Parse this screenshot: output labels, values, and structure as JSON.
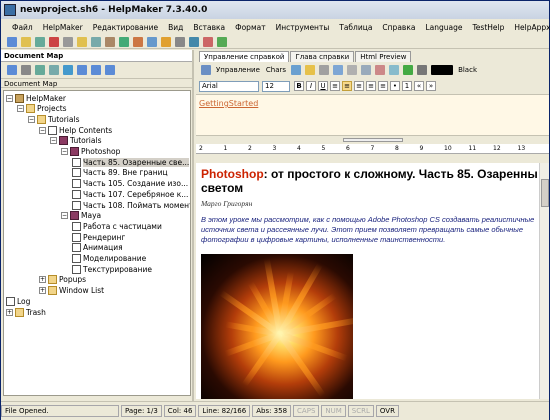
{
  "window": {
    "title": "newproject.sh6 - HelpMaker 7.3.40.0"
  },
  "menu": [
    "Файл",
    "HelpMaker",
    "Редактирование",
    "Вид",
    "Вставка",
    "Формат",
    "Инструменты",
    "Таблица",
    "Справка",
    "Language",
    "TestHelp",
    "HelpAppx"
  ],
  "left": {
    "header": "Document Map",
    "sublabel": "Document Map",
    "tree": [
      {
        "label": "HelpMaker",
        "icon": "home-icon",
        "depth": 0
      },
      {
        "label": "Projects",
        "icon": "folder-icon",
        "depth": 1
      },
      {
        "label": "Tutorials",
        "icon": "folder-icon",
        "depth": 2
      },
      {
        "label": "Help Contents",
        "icon": "page-icon",
        "depth": 3
      },
      {
        "label": "Tutorials",
        "icon": "book-icon",
        "depth": 4
      },
      {
        "label": "Photoshop",
        "icon": "book-icon",
        "depth": 5
      },
      {
        "label": "Часть 85. Озаренные све...",
        "icon": "page-icon",
        "depth": 6,
        "selected": true
      },
      {
        "label": "Часть 89. Вне границ",
        "icon": "page-icon",
        "depth": 6
      },
      {
        "label": "Часть 105. Создание изо...",
        "icon": "page-icon",
        "depth": 6
      },
      {
        "label": "Часть 107. Серебряное к...",
        "icon": "page-icon",
        "depth": 6
      },
      {
        "label": "Часть 108. Поймать момент",
        "icon": "page-icon",
        "depth": 6
      },
      {
        "label": "Maya",
        "icon": "book-icon",
        "depth": 5
      },
      {
        "label": "Работа с частицами",
        "icon": "page-icon",
        "depth": 6
      },
      {
        "label": "Рендеринг",
        "icon": "page-icon",
        "depth": 6
      },
      {
        "label": "Анимация",
        "icon": "page-icon",
        "depth": 6
      },
      {
        "label": "Моделирование",
        "icon": "page-icon",
        "depth": 6
      },
      {
        "label": "Текстурирование",
        "icon": "page-icon",
        "depth": 6
      },
      {
        "label": "Popups",
        "icon": "folder-icon",
        "depth": 3
      },
      {
        "label": "Window List",
        "icon": "folder-icon",
        "depth": 3
      },
      {
        "label": "Log",
        "icon": "page-icon",
        "depth": 0
      },
      {
        "label": "Trash",
        "icon": "folder-icon",
        "depth": 0
      }
    ]
  },
  "right": {
    "tabs": [
      "Управление справкой",
      "Главa справки",
      "Html Preview"
    ],
    "toolbar1": {
      "manage_label": "Управление",
      "chars_label": "Chars",
      "color_label": "Black"
    },
    "toolbar2": {
      "font": "Arial",
      "size": "12"
    },
    "topic_link": "GettingStarted",
    "ruler_marks": [
      "2",
      "1",
      "2",
      "3",
      "4",
      "5",
      "6",
      "7",
      "8",
      "9",
      "10",
      "11",
      "12",
      "13"
    ],
    "doc": {
      "title_accent": "Photoshop",
      "title_rest": ": от простого к сложному. Часть 85. Озаренны светом",
      "author": "Марго Григорян",
      "intro": "В этом уроке мы рассмотрим, как с помощью Adobe Photoshop CS создавать реалистичные источник света и рассеянные лучи. Этот прием позволяет превращать самые обычные фотографии в цифровые картины, исполненные таинственности."
    }
  },
  "status": {
    "message": "File Opened.",
    "page": "Page: 1/3",
    "col": "Col: 46",
    "line": "Line: 82/166",
    "abs": "Abs: 358",
    "caps": "CAPS",
    "num": "NUM",
    "scrl": "SCRL",
    "ovr": "OVR"
  },
  "colors": {
    "accent": "#cc2200",
    "link": "#cc6633",
    "selection": "#d4d0c8"
  }
}
